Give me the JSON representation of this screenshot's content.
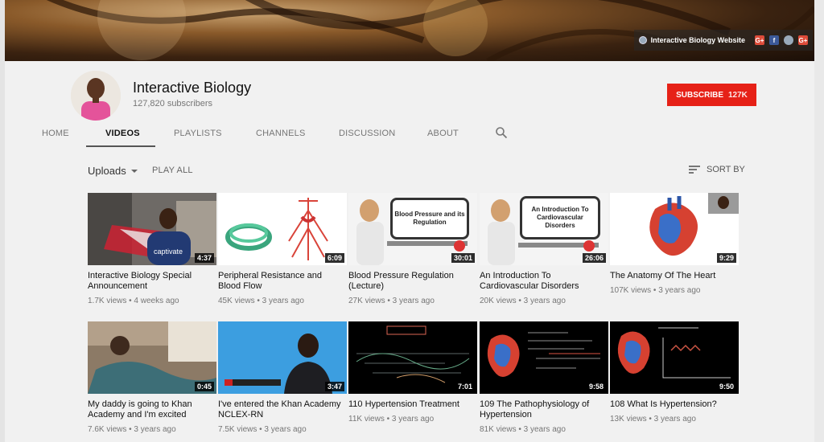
{
  "banner": {
    "website_label": "Interactive Biology Website",
    "social": [
      {
        "icon": "google-plus-icon",
        "text": "G+"
      },
      {
        "icon": "facebook-icon",
        "text": "f"
      },
      {
        "icon": "globe-icon",
        "text": ""
      },
      {
        "icon": "google-plus-icon",
        "text": "G+"
      }
    ]
  },
  "channel": {
    "title": "Interactive Biology",
    "subscribers": "127,820 subscribers",
    "subscribe_label": "SUBSCRIBE",
    "subscribe_count": "127K"
  },
  "tabs": [
    "HOME",
    "VIDEOS",
    "PLAYLISTS",
    "CHANNELS",
    "DISCUSSION",
    "ABOUT"
  ],
  "active_tab": "VIDEOS",
  "toolbar": {
    "uploads_label": "Uploads",
    "play_all": "PLAY ALL",
    "sort_by": "SORT BY"
  },
  "videos": [
    {
      "title": "Interactive Biology Special Announcement",
      "views": "1.7K views",
      "age": "4 weeks ago",
      "duration": "4:37"
    },
    {
      "title": "Peripheral Resistance and Blood Flow",
      "views": "45K views",
      "age": "3 years ago",
      "duration": "6:09"
    },
    {
      "title": "Blood Pressure Regulation (Lecture)",
      "views": "27K views",
      "age": "3 years ago",
      "duration": "30:01",
      "board": "Blood Pressure and its Regulation"
    },
    {
      "title": "An Introduction To Cardiovascular Disorders",
      "views": "20K views",
      "age": "3 years ago",
      "duration": "26:06",
      "board": "An Introduction To Cardiovascular Disorders"
    },
    {
      "title": "The Anatomy Of The Heart",
      "views": "107K views",
      "age": "3 years ago",
      "duration": "9:29"
    },
    {
      "title": "My daddy is going to Khan Academy and I'm excited",
      "views": "7.6K views",
      "age": "3 years ago",
      "duration": "0:45"
    },
    {
      "title": "I've entered the Khan Academy NCLEX-RN",
      "views": "7.5K views",
      "age": "3 years ago",
      "duration": "3:47"
    },
    {
      "title": "110 Hypertension Treatment",
      "views": "11K views",
      "age": "3 years ago",
      "duration": "7:01"
    },
    {
      "title": "109 The Pathophysiology of Hypertension",
      "views": "81K views",
      "age": "3 years ago",
      "duration": "9:58"
    },
    {
      "title": "108 What Is Hypertension?",
      "views": "13K views",
      "age": "3 years ago",
      "duration": "9:50"
    }
  ]
}
